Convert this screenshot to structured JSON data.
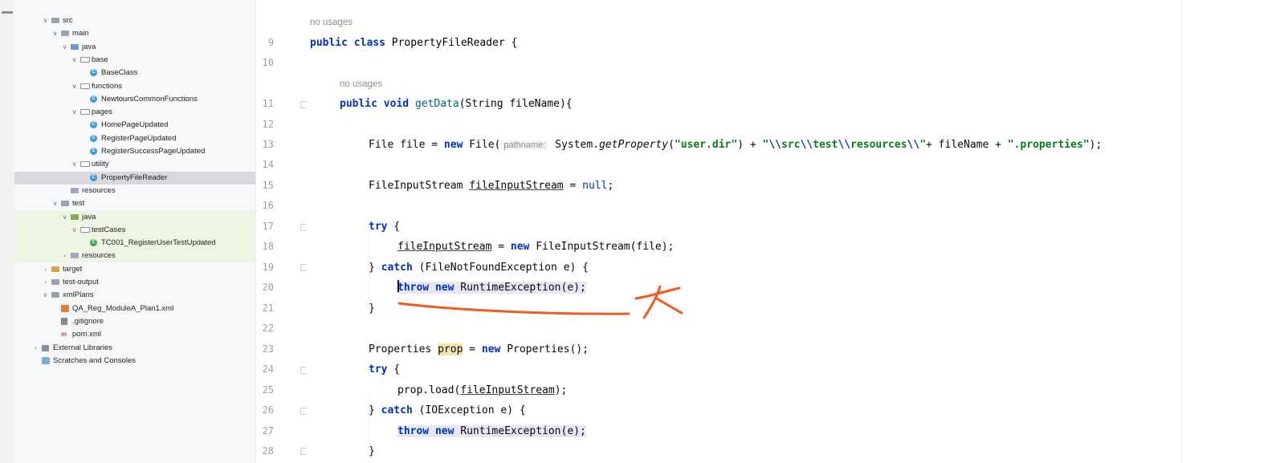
{
  "project_tree": {
    "items": [
      {
        "label": "src",
        "level": 2,
        "arrow": "down",
        "icon": "folder"
      },
      {
        "label": "main",
        "level": 3,
        "arrow": "down",
        "icon": "folder"
      },
      {
        "label": "java",
        "level": 4,
        "arrow": "down",
        "icon": "folder-blue"
      },
      {
        "label": "base",
        "level": 5,
        "arrow": "down",
        "icon": "folder-pkg"
      },
      {
        "label": "BaseClass",
        "level": 6,
        "arrow": "",
        "icon": "class"
      },
      {
        "label": "functions",
        "level": 5,
        "arrow": "down",
        "icon": "folder-pkg"
      },
      {
        "label": "NewtoursCommonFunctions",
        "level": 6,
        "arrow": "",
        "icon": "class"
      },
      {
        "label": "pages",
        "level": 5,
        "arrow": "down",
        "icon": "folder-pkg"
      },
      {
        "label": "HomePageUpdated",
        "level": 6,
        "arrow": "",
        "icon": "class"
      },
      {
        "label": "RegisterPageUpdated",
        "level": 6,
        "arrow": "",
        "icon": "class"
      },
      {
        "label": "RegisterSuccessPageUpdated",
        "level": 6,
        "arrow": "",
        "icon": "class"
      },
      {
        "label": "utility",
        "level": 5,
        "arrow": "down",
        "icon": "folder-pkg"
      },
      {
        "label": "PropertyFileReader",
        "level": 6,
        "arrow": "",
        "icon": "class",
        "selected": true
      },
      {
        "label": "resources",
        "level": 4,
        "arrow": "",
        "icon": "folder-res"
      },
      {
        "label": "test",
        "level": 3,
        "arrow": "down",
        "icon": "folder"
      },
      {
        "label": "java",
        "level": 4,
        "arrow": "down",
        "icon": "folder-green",
        "test": true
      },
      {
        "label": "testCases",
        "level": 5,
        "arrow": "down",
        "icon": "folder-pkg",
        "test": true
      },
      {
        "label": "TC001_RegisterUserTestUpdated",
        "level": 6,
        "arrow": "",
        "icon": "class-green",
        "test": true
      },
      {
        "label": "resources",
        "level": 4,
        "arrow": "right",
        "icon": "folder-res",
        "test": true
      },
      {
        "label": "target",
        "level": 2,
        "arrow": "right",
        "icon": "folder-orange"
      },
      {
        "label": "test-output",
        "level": 2,
        "arrow": "right",
        "icon": "folder"
      },
      {
        "label": "xmlPlans",
        "level": 2,
        "arrow": "down",
        "icon": "folder"
      },
      {
        "label": "QA_Reg_ModuleA_Plan1.xml",
        "level": 3,
        "arrow": "",
        "icon": "xml"
      },
      {
        "label": ".gitignore",
        "level": 3,
        "arrow": "",
        "icon": "git"
      },
      {
        "label": "pom.xml",
        "level": 3,
        "arrow": "",
        "icon": "maven"
      },
      {
        "label": "External Libraries",
        "level": 1,
        "arrow": "right",
        "icon": "lib"
      },
      {
        "label": "Scratches and Consoles",
        "level": 1,
        "arrow": "",
        "icon": "scratch"
      }
    ]
  },
  "editor": {
    "hints": {
      "class_usages": "no usages",
      "method_usages": "no usages"
    },
    "line_numbers": [
      "9",
      "10",
      "11",
      "12",
      "13",
      "14",
      "15",
      "16",
      "17",
      "18",
      "19",
      "20",
      "21",
      "22",
      "23",
      "24",
      "25",
      "26",
      "27",
      "28"
    ],
    "code": {
      "l9": {
        "kw1": "public",
        "kw2": "class",
        "name": "PropertyFileReader",
        "rest": " {"
      },
      "l11": {
        "kw1": "public",
        "kw2": "void",
        "method": "getData",
        "rest": "(String fileName){"
      },
      "l13": {
        "a": "File file = ",
        "kw": "new",
        "b": " File(",
        "param": "pathname:",
        "c": " System.",
        "d": "getProperty",
        "e": "(",
        "s1": "\"user.dir\"",
        "f": ") + ",
        "s2a": "\"",
        "esc1": "\\\\",
        "s2b": "src",
        "esc2": "\\\\",
        "s2c": "test",
        "esc3": "\\\\",
        "s2d": "resources",
        "esc4": "\\\\",
        "s2e": "\"",
        "g": "+ fileName + ",
        "s3": "\".properties\"",
        "h": ");"
      },
      "l15": {
        "a": "FileInputStream ",
        "var": "fileInputStream",
        "b": " = ",
        "nul": "null",
        "c": ";"
      },
      "l17": {
        "kw": "try",
        "rest": " {"
      },
      "l18": {
        "var": "fileInputStream",
        "a": " = ",
        "kw": "new",
        "b": " FileInputStream(file);"
      },
      "l19": {
        "a": "} ",
        "kw": "catch",
        "b": " (FileNotFoundException e) {"
      },
      "l20": {
        "kw1": "throw",
        "kw2": "new",
        "rest": " RuntimeException(e);"
      },
      "l21": {
        "a": "}"
      },
      "l23": {
        "a": "Properties ",
        "var": "prop",
        "b": " = ",
        "kw": "new",
        "c": " Properties();"
      },
      "l24": {
        "kw": "try",
        "rest": " {"
      },
      "l25": {
        "a": "prop.load(",
        "var": "fileInputStream",
        "b": ");"
      },
      "l26": {
        "a": "} ",
        "kw": "catch",
        "b": " (IOException e) {"
      },
      "l27": {
        "kw1": "throw",
        "kw2": "new",
        "rest": " RuntimeException(e);"
      },
      "l28": {
        "a": "}"
      }
    }
  },
  "colors": {
    "keyword": "#0033b3",
    "string": "#067d17",
    "annotation_ink": "#f15a22",
    "caret_row": "#fcfae8",
    "sidebar_bg": "#f7f8fa"
  }
}
